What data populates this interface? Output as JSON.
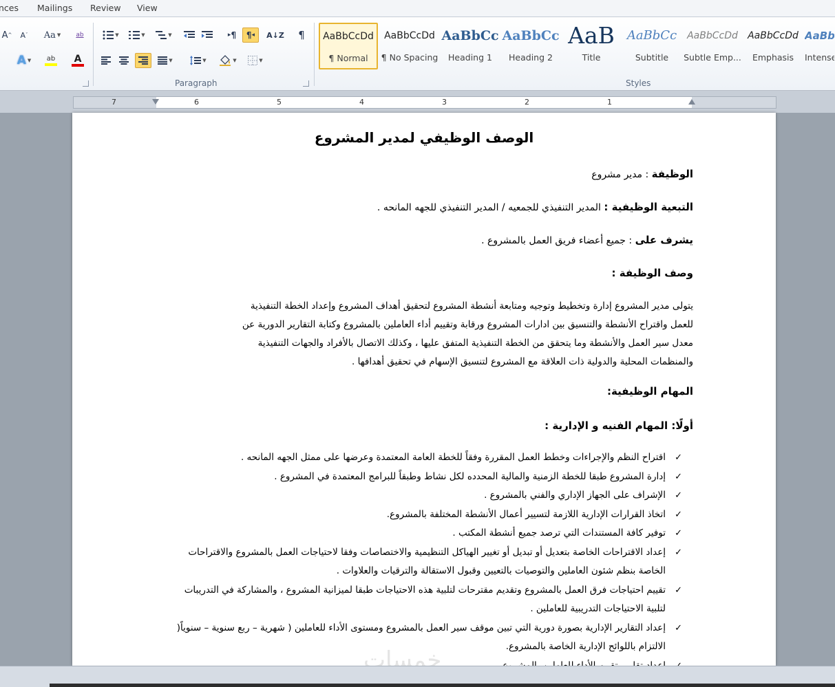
{
  "ribbon_tabs": [
    "nces",
    "Mailings",
    "Review",
    "View"
  ],
  "font_group": {
    "grow_font_label": "A",
    "shrink_font_label": "A",
    "change_case_label": "Aa",
    "clear_format_label": "ab",
    "text_effects_label": "A",
    "highlight_label": "ab",
    "font_color_label": "A",
    "highlight_color": "#ffff00",
    "font_color": "#e00000"
  },
  "paragraph_group": {
    "label": "Paragraph",
    "show_marks_label": "¶",
    "ltr_label": "¶",
    "rtl_label": "¶",
    "sort_label": "A↓Z"
  },
  "styles_group": {
    "label": "Styles",
    "styles": [
      {
        "sample": "AaBbCcDd",
        "name": "¶ Normal"
      },
      {
        "sample": "AaBbCcDd",
        "name": "¶ No Spacing"
      },
      {
        "sample": "AaBbCc",
        "name": "Heading 1"
      },
      {
        "sample": "AaBbCc",
        "name": "Heading 2"
      },
      {
        "sample": "AaB",
        "name": "Title"
      },
      {
        "sample": "AaBbCc",
        "name": "Subtitle"
      },
      {
        "sample": "AaBbCcDd",
        "name": "Subtle Emp..."
      },
      {
        "sample": "AaBbCcDd",
        "name": "Emphasis"
      },
      {
        "sample": "AaBb",
        "name": "Intense"
      }
    ]
  },
  "ruler": {
    "numbers": [
      "7",
      "6",
      "5",
      "4",
      "3",
      "2",
      "1"
    ]
  },
  "document": {
    "title": "الوصف الوظيفي لمدير المشروع",
    "job_label": "الوظيفة",
    "job_value": ":  مدير مشروع",
    "reports_label": "التبعية الوظيفية :",
    "reports_value": "المدير التنفيذي للجمعيه / المدير التنفيذي للجهه المانحه .",
    "supervises_label": "يشرف على",
    "supervises_value": ":  جميع أعضاء فريق العمل بالمشروع  .",
    "desc_heading": "وصف الوظيفة :",
    "desc_lines": [
      "يتولى مدير المشروع  إدارة وتخطيط وتوجيه ومتابعة أنشطة المشروع  لتحقيق أهداف المشروع  وإعداد الخطة التنفيذية",
      "للعمل واقتراح الأنشطة والتنسيق بين ادارات المشروع ورقابة وتقييم أداء العاملين بالمشروع  وكتابة التقارير الدورية عن",
      "معدل سير العمل والأنشطة وما يتحقق من الخطة التنفيذية المتفق عليها ، وكذلك الاتصال بالأفراد والجهات التنفيذية",
      "والمنظمات المحلية والدولية ذات العلاقة مع المشروع  لتنسيق الإسهام في تحقيق أهدافها ."
    ],
    "tasks_heading": "المهام الوظيفية:",
    "tech_heading": "أولًا: المهام الفنيه و الإدارية :",
    "bullets": [
      "اقتراح النظم والإجراءات وخطط العمل المقررة وفقاً للخطة العامة المعتمدة وعرضها على ممثل الجهه المانحه .",
      "إدارة المشروع طبقا للخطة الزمنية والمالية المحدده لكل نشاط وطبقاً للبرامج المعتمدة في المشروع   .",
      "الإشراف على الجهاز الإداري والفني بالمشروع .",
      "اتخاذ القرارات الإدارية اللازمة لتسيير أعمال الأنشطة المختلفة بالمشروع.",
      "توفير كافة المستندات   التي ترصد  جميع أنشطة المكتب .",
      "إعداد الاقتراحات الخاصة بتعديل أو تبديل أو تغيير الهياكل التنظيمية والاختصاصات وفقا لاحتياجات العمل بالمشروع  والاقتراحات الخاصة بنظم شئون العاملين والتوصيات بالتعيين وقبول الاستقالة والترقيات والعلاوات .",
      "تقييم احتياجات فرق العمل بالمشروع  وتقديم مقترحات لتلبية هذه الاحتياجات طبقا لميزانية المشروع ، والمشاركة في التدريبات لتلبية الاحتياجات التدريبية للعاملين .",
      "إعداد التقارير الإدارية بصورة دورية التي تبين موقف سير العمل بالمشروع ومستوى الأداء للعاملين  ( شهرية – ربع سنوية – سنوياً(  الالتزام باللوائح الإدارية الخاصة بالمشروع.",
      "إعداد تقارير تقييم الأداء للعاملين بالمشروع ."
    ],
    "bullet_mark": "✓"
  },
  "watermark": "خمسات"
}
